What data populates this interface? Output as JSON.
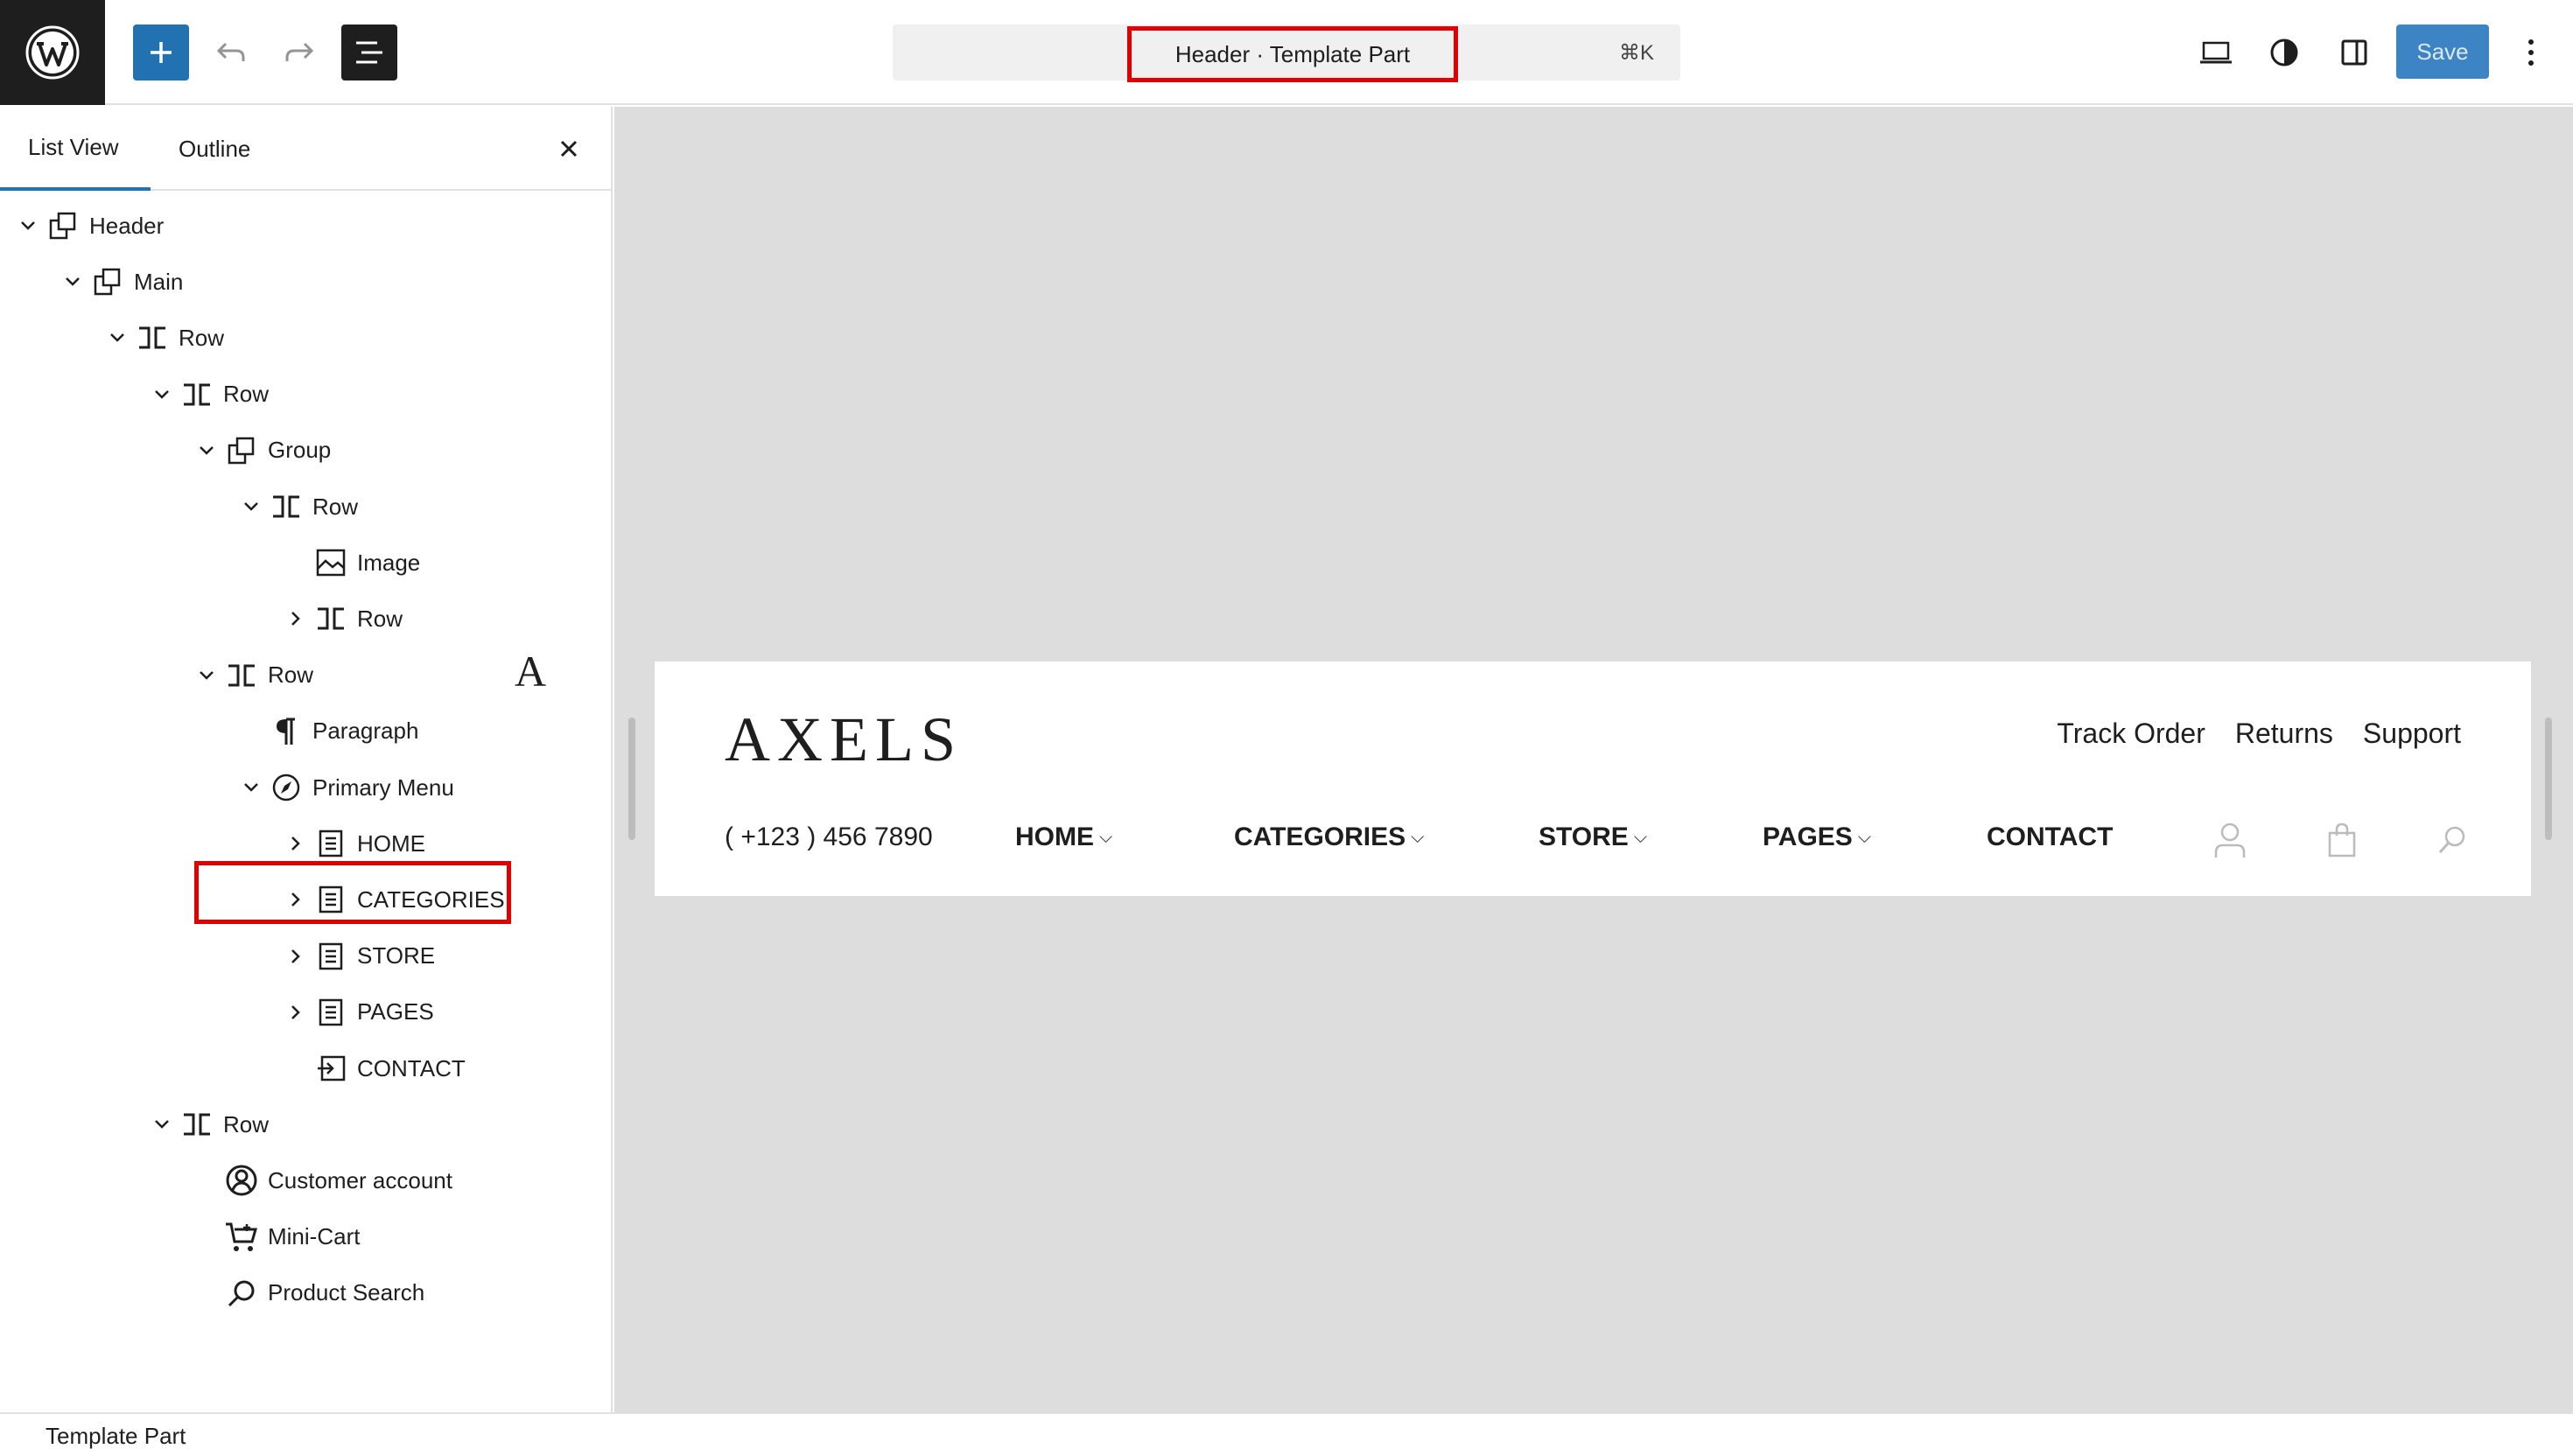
{
  "toolbar": {
    "logo_icon": "wordpress-logo-icon",
    "add_icon": "plus-icon",
    "undo_icon": "undo-icon",
    "redo_icon": "redo-icon",
    "list_view_icon": "list-view-icon",
    "document_title": "Header · Template Part",
    "shortcut": "⌘K",
    "device_icon": "laptop-icon",
    "styles_icon": "half-circle-icon",
    "settings_icon": "sidebar-icon",
    "save_label": "Save",
    "more_icon": "vertical-ellipsis-icon",
    "accent_color": "#2271b1"
  },
  "sidebar": {
    "tabs": [
      {
        "label": "List View",
        "active": true
      },
      {
        "label": "Outline",
        "active": false
      }
    ],
    "close_icon": "close-icon",
    "tree": [
      {
        "label": "Header",
        "icon": "template-part-icon",
        "chevron": "down",
        "depth": 0
      },
      {
        "label": "Main",
        "icon": "group-icon",
        "chevron": "down",
        "depth": 1
      },
      {
        "label": "Row",
        "icon": "row-icon",
        "chevron": "down",
        "depth": 2
      },
      {
        "label": "Row",
        "icon": "row-icon",
        "chevron": "down",
        "depth": 3
      },
      {
        "label": "Group",
        "icon": "group-icon",
        "chevron": "down",
        "depth": 4
      },
      {
        "label": "Row",
        "icon": "row-icon",
        "chevron": "down",
        "depth": 5
      },
      {
        "label": "Image",
        "icon": "image-icon",
        "chevron": "none",
        "depth": 6
      },
      {
        "label": "Row",
        "icon": "row-icon",
        "chevron": "right",
        "depth": 6
      },
      {
        "label": "Row",
        "icon": "row-icon",
        "chevron": "down",
        "depth": 4
      },
      {
        "label": "Paragraph",
        "icon": "paragraph-icon",
        "chevron": "none",
        "depth": 5
      },
      {
        "label": "Primary Menu",
        "icon": "navigation-icon",
        "chevron": "down",
        "depth": 5
      },
      {
        "label": "HOME",
        "icon": "page-icon",
        "chevron": "right",
        "depth": 6
      },
      {
        "label": "CATEGORIES",
        "icon": "page-icon",
        "chevron": "right",
        "depth": 6
      },
      {
        "label": "STORE",
        "icon": "page-icon",
        "chevron": "right",
        "depth": 6
      },
      {
        "label": "PAGES",
        "icon": "page-icon",
        "chevron": "right",
        "depth": 6
      },
      {
        "label": "CONTACT",
        "icon": "custom-link-icon",
        "chevron": "none",
        "depth": 6
      },
      {
        "label": "Row",
        "icon": "row-icon",
        "chevron": "down",
        "depth": 3
      },
      {
        "label": "Customer account",
        "icon": "user-circle-icon",
        "chevron": "none",
        "depth": 4
      },
      {
        "label": "Mini-Cart",
        "icon": "cart-icon",
        "chevron": "none",
        "depth": 4
      },
      {
        "label": "Product Search",
        "icon": "search-icon",
        "chevron": "none",
        "depth": 4
      }
    ],
    "image_preview_letter": "A"
  },
  "footer": {
    "breadcrumb": "Template Part"
  },
  "preview": {
    "brand": "AXELS",
    "top_links": [
      "Track Order",
      "Returns",
      "Support"
    ],
    "phone": "( +123 ) 456 7890",
    "menu": [
      {
        "label": "HOME",
        "has_submenu": true
      },
      {
        "label": "CATEGORIES",
        "has_submenu": true
      },
      {
        "label": "STORE",
        "has_submenu": true
      },
      {
        "label": "PAGES",
        "has_submenu": true
      },
      {
        "label": "CONTACT",
        "has_submenu": false
      }
    ],
    "caret": "⌵",
    "icons": [
      "user-icon",
      "bag-icon",
      "search-icon"
    ]
  }
}
